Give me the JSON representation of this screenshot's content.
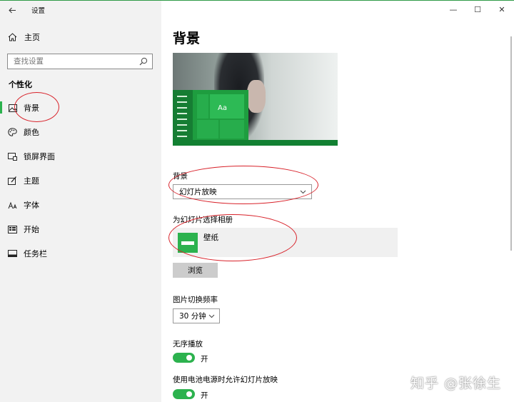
{
  "app": {
    "title": "设置"
  },
  "sidebar": {
    "home_label": "主页",
    "search_placeholder": "查找设置",
    "section_label": "个性化",
    "items": [
      {
        "label": "背景",
        "icon": "picture-icon",
        "active": true
      },
      {
        "label": "颜色",
        "icon": "palette-icon"
      },
      {
        "label": "锁屏界面",
        "icon": "lock-screen-icon"
      },
      {
        "label": "主题",
        "icon": "theme-icon"
      },
      {
        "label": "字体",
        "icon": "font-icon"
      },
      {
        "label": "开始",
        "icon": "start-icon"
      },
      {
        "label": "任务栏",
        "icon": "taskbar-icon"
      }
    ]
  },
  "window_controls": {
    "minimize": "—",
    "maximize": "☐",
    "close": "✕"
  },
  "main": {
    "title": "背景",
    "preview_tile_text": "Aa",
    "background_label": "背景",
    "background_value": "幻灯片放映",
    "album_label": "为幻灯片选择相册",
    "album_name": "壁纸",
    "browse_label": "浏览",
    "interval_label": "图片切换频率",
    "interval_value": "30 分钟",
    "shuffle_label": "无序播放",
    "shuffle_state": "开",
    "battery_label": "使用电池电源时允许幻灯片放映",
    "battery_state": "开"
  },
  "watermark": "知乎 @张徐生",
  "colors": {
    "accent": "#2cb24e",
    "annotation": "#d8222a"
  }
}
